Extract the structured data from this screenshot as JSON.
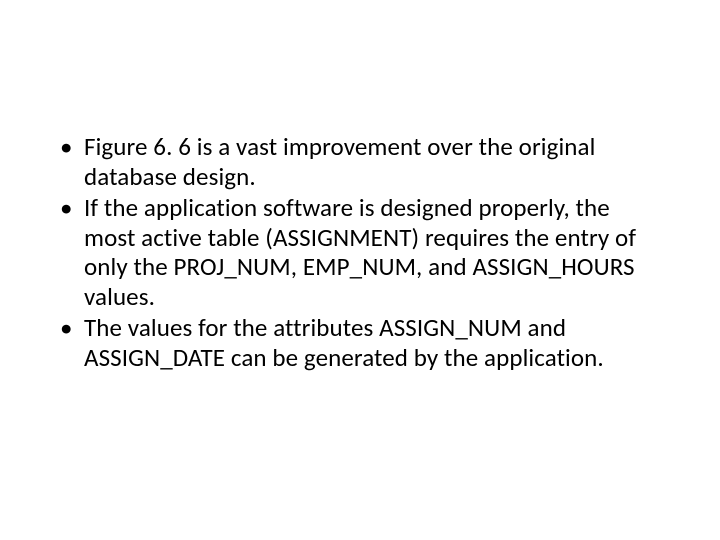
{
  "bullets": [
    "Figure 6. 6 is a vast improvement over the original database design.",
    "If the application software is designed properly, the most active table (ASSIGNMENT) requires the entry of only the PROJ_NUM, EMP_NUM, and ASSIGN_HOURS values.",
    "The values for the attributes ASSIGN_NUM and ASSIGN_DATE can be generated by the application."
  ]
}
